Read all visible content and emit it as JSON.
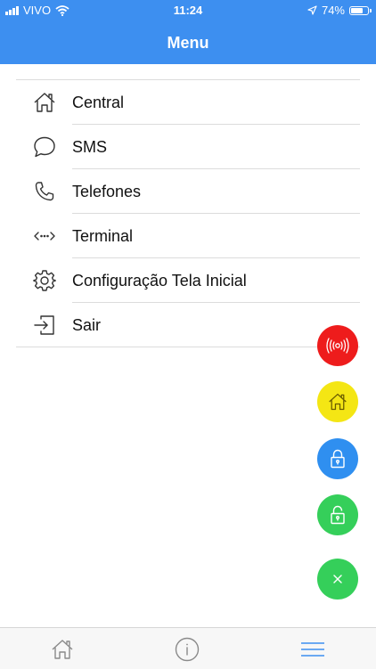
{
  "status_bar": {
    "carrier": "VIVO",
    "time": "11:24",
    "battery_percent": "74%",
    "battery_level": 0.74
  },
  "header": {
    "title": "Menu"
  },
  "menu": {
    "items": [
      {
        "label": "Central",
        "icon": "home-icon"
      },
      {
        "label": "SMS",
        "icon": "chat-bubble-icon"
      },
      {
        "label": "Telefones",
        "icon": "phone-icon"
      },
      {
        "label": "Terminal",
        "icon": "terminal-arrows-icon"
      },
      {
        "label": "Configuração Tela Inicial",
        "icon": "gear-icon"
      },
      {
        "label": "Sair",
        "icon": "logout-icon"
      }
    ]
  },
  "fab_buttons": [
    {
      "icon": "alarm-siren-icon",
      "color": "#ee1c1c"
    },
    {
      "icon": "home-icon",
      "color": "#f4e614"
    },
    {
      "icon": "lock-icon",
      "color": "#2f8ff0"
    },
    {
      "icon": "unlock-icon",
      "color": "#35cf5a"
    },
    {
      "icon": "close-icon",
      "color": "#35cf5a"
    }
  ],
  "tab_bar": {
    "items": [
      {
        "icon": "home-icon"
      },
      {
        "icon": "info-icon"
      },
      {
        "icon": "hamburger-menu-icon",
        "active": true
      }
    ],
    "active_color": "#3d8ff0"
  },
  "colors": {
    "primary": "#3d8ff0",
    "header_text": "#ffffff"
  }
}
